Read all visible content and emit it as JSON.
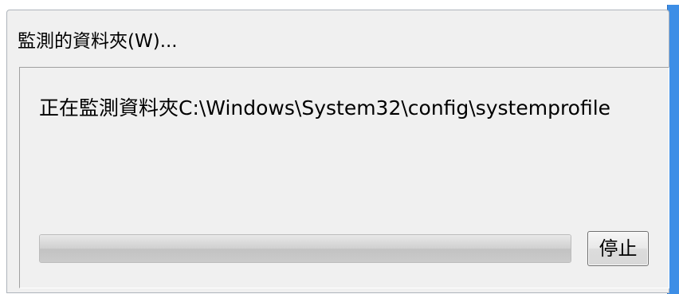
{
  "menu": {
    "title": "監測的資料夾(W)..."
  },
  "status": {
    "text": "正在監測資料夾C:\\Windows\\System32\\config\\systemprofile"
  },
  "progress": {
    "fraction": 1.0
  },
  "buttons": {
    "stop_label": "停止"
  },
  "colors": {
    "panel_bg": "#f0f0f0",
    "edge_accent": "#3d8ee6"
  }
}
